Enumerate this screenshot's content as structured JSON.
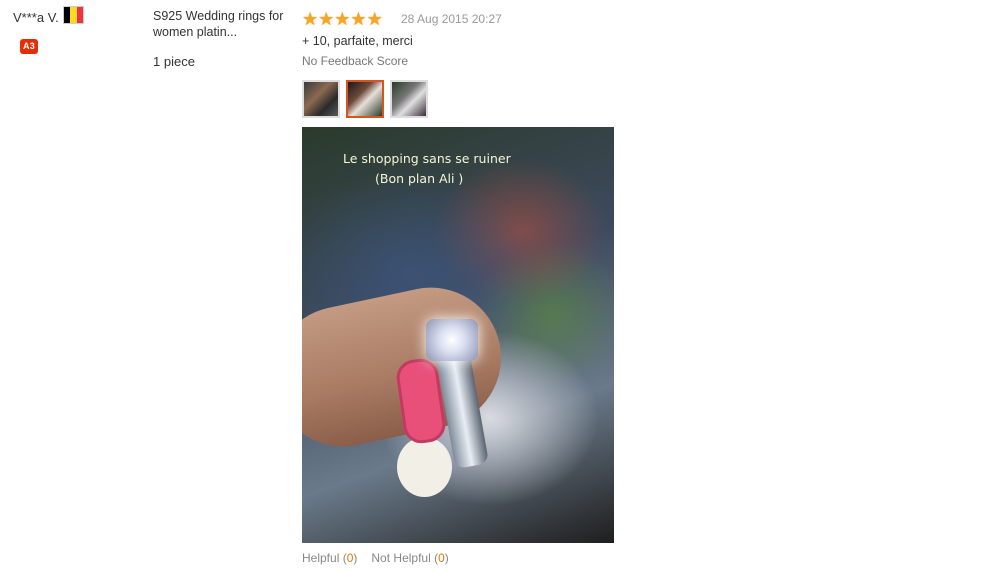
{
  "buyer": {
    "name": "V***a V.",
    "badge": "A3",
    "flag_colors": [
      "#000000",
      "#fdda24",
      "#ef3340"
    ]
  },
  "product": {
    "title": "S925 Wedding rings for women platin...",
    "quantity": "1 piece"
  },
  "review": {
    "stars": [
      "★",
      "★",
      "★",
      "★",
      "★"
    ],
    "star_color": "#f5a623",
    "date": "28 Aug 2015 20:27",
    "comment": "+ 10, parfaite, merci",
    "feedback_score": "No Feedback Score",
    "photo_caption_line1": "Le shopping sans se ruiner",
    "photo_caption_line2": "(Bon plan Ali )",
    "selected_thumbnail": 2
  },
  "actions": {
    "helpful_label": "Helpful",
    "helpful_open": " (",
    "helpful_count": "0",
    "helpful_close": ")",
    "not_helpful_label": "Not Helpful",
    "not_helpful_open": " (",
    "not_helpful_count": "0",
    "not_helpful_close": ")"
  }
}
